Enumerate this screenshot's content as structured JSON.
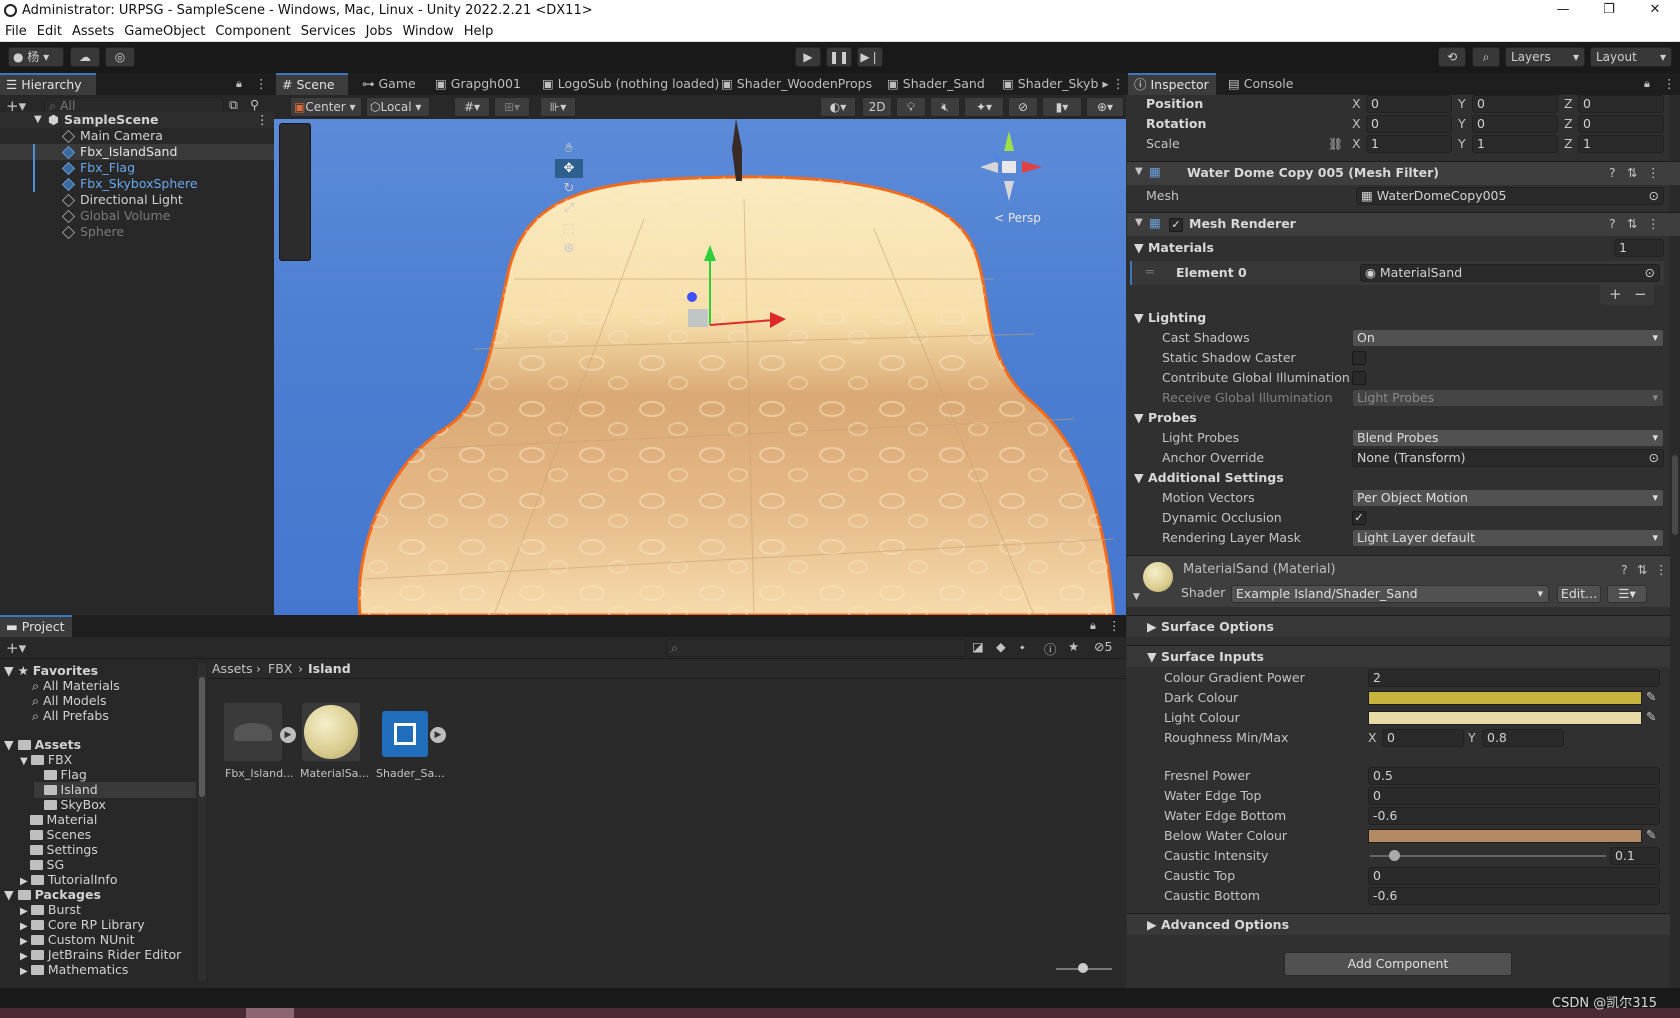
{
  "window": {
    "title": "Administrator: URPSG - SampleScene - Windows, Mac, Linux - Unity 2022.2.21 <DX11>"
  },
  "menu": [
    "File",
    "Edit",
    "Assets",
    "GameObject",
    "Component",
    "Services",
    "Jobs",
    "Window",
    "Help"
  ],
  "toolbar": {
    "account": "杨",
    "layers": "Layers",
    "layout": "Layout"
  },
  "hierarchy": {
    "tab": "Hierarchy",
    "search_placeholder": "All",
    "scene": "SampleScene",
    "items": [
      {
        "label": "Main Camera",
        "state": "normal"
      },
      {
        "label": "Fbx_IslandSand",
        "state": "selected"
      },
      {
        "label": "Fbx_Flag",
        "state": "prefab"
      },
      {
        "label": "Fbx_SkyboxSphere",
        "state": "prefab"
      },
      {
        "label": "Directional Light",
        "state": "normal"
      },
      {
        "label": "Global Volume",
        "state": "disabled"
      },
      {
        "label": "Sphere",
        "state": "disabled"
      }
    ]
  },
  "scene_tabs": [
    "Scene",
    "Game",
    "Grapgh001",
    "LogoSub (nothing loaded)",
    "Shader_WoodenProps",
    "Shader_Sand",
    "Shader_Skyb"
  ],
  "scene_toolbar": {
    "pivot": "Center",
    "space": "Local",
    "mode_2d": "2D",
    "persp": "< Persp"
  },
  "inspector": {
    "tabs": [
      "Inspector",
      "Console"
    ],
    "transform": {
      "position": {
        "label": "Position",
        "x": "0",
        "y": "0",
        "z": "0"
      },
      "rotation": {
        "label": "Rotation",
        "x": "0",
        "y": "0",
        "z": "0"
      },
      "scale": {
        "label": "Scale",
        "x": "1",
        "y": "1",
        "z": "1"
      }
    },
    "mesh_filter": {
      "title": "Water Dome Copy 005 (Mesh Filter)",
      "mesh_label": "Mesh",
      "mesh_value": "WaterDomeCopy005"
    },
    "mesh_renderer": {
      "title": "Mesh Renderer",
      "materials_label": "Materials",
      "materials_count": "1",
      "element0_label": "Element 0",
      "element0_value": "MaterialSand",
      "lighting": "Lighting",
      "cast_shadows": {
        "label": "Cast Shadows",
        "value": "On"
      },
      "static_shadow": "Static Shadow Caster",
      "contribute_gi": "Contribute Global Illumination",
      "receive_gi": {
        "label": "Receive Global Illumination",
        "value": "Light Probes"
      },
      "probes": "Probes",
      "light_probes": {
        "label": "Light Probes",
        "value": "Blend Probes"
      },
      "anchor_override": {
        "label": "Anchor Override",
        "value": "None (Transform)"
      },
      "additional": "Additional Settings",
      "motion_vectors": {
        "label": "Motion Vectors",
        "value": "Per Object Motion"
      },
      "dynamic_occlusion": "Dynamic Occlusion",
      "rendering_layer": {
        "label": "Rendering Layer Mask",
        "value": "Light Layer default"
      }
    },
    "material": {
      "title": "MaterialSand (Material)",
      "shader_label": "Shader",
      "shader_value": "Example Island/Shader_Sand",
      "edit": "Edit...",
      "surface_options": "Surface Options",
      "surface_inputs": "Surface Inputs",
      "props": [
        {
          "label": "Colour Gradient Power",
          "value": "2"
        },
        {
          "label": "Dark Colour",
          "color": "#c7b43f"
        },
        {
          "label": "Light Colour",
          "color": "#e6dba6"
        }
      ],
      "roughness": {
        "label": "Roughness Min/Max",
        "x": "0",
        "y": "0.8"
      },
      "props2": [
        {
          "label": "Fresnel Power",
          "value": "0.5"
        },
        {
          "label": "Water Edge Top",
          "value": "0"
        },
        {
          "label": "Water Edge Bottom",
          "value": "-0.6"
        }
      ],
      "below_water": {
        "label": "Below Water Colour",
        "color": "#b38a63"
      },
      "caustic_intensity": {
        "label": "Caustic Intensity",
        "value": "0.1",
        "fraction": 0.1
      },
      "props3": [
        {
          "label": "Caustic Top",
          "value": "0"
        },
        {
          "label": "Caustic Bottom",
          "value": "-0.6"
        }
      ],
      "advanced": "Advanced Options"
    },
    "add_component": "Add Component"
  },
  "project": {
    "tab": "Project",
    "hidden_count": "5",
    "favorites": {
      "label": "Favorites",
      "items": [
        "All Materials",
        "All Models",
        "All Prefabs"
      ]
    },
    "assets_label": "Assets",
    "tree": [
      {
        "label": "FBX",
        "depth": 1
      },
      {
        "label": "Flag",
        "depth": 2
      },
      {
        "label": "Island",
        "depth": 2
      },
      {
        "label": "SkyBox",
        "depth": 2
      },
      {
        "label": "Material",
        "depth": 1
      },
      {
        "label": "Scenes",
        "depth": 1
      },
      {
        "label": "Settings",
        "depth": 1
      },
      {
        "label": "SG",
        "depth": 1
      },
      {
        "label": "TutorialInfo",
        "depth": 1
      }
    ],
    "packages_label": "Packages",
    "packages": [
      "Burst",
      "Core RP Library",
      "Custom NUnit",
      "JetBrains Rider Editor",
      "Mathematics"
    ],
    "breadcrumb": [
      "Assets",
      "FBX",
      "Island"
    ],
    "assets": [
      {
        "label": "Fbx_Island..."
      },
      {
        "label": "MaterialSa..."
      },
      {
        "label": "Shader_Sa..."
      }
    ]
  },
  "watermark": "CSDN @凯尔315"
}
